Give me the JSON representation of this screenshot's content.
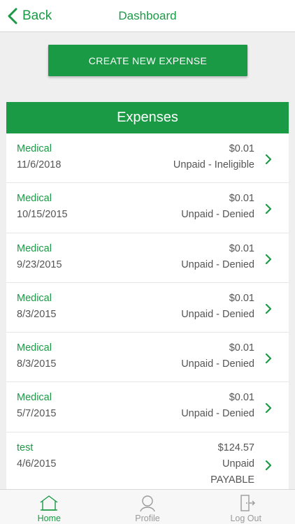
{
  "nav": {
    "back_label": "Back",
    "title": "Dashboard"
  },
  "create_button": "CREATE NEW EXPENSE",
  "expenses": {
    "header": "Expenses",
    "rows": [
      {
        "category": "Medical",
        "date": "11/6/2018",
        "amount": "$0.01",
        "status": "Unpaid - Ineligible"
      },
      {
        "category": "Medical",
        "date": "10/15/2015",
        "amount": "$0.01",
        "status": "Unpaid - Denied"
      },
      {
        "category": "Medical",
        "date": "9/23/2015",
        "amount": "$0.01",
        "status": "Unpaid - Denied"
      },
      {
        "category": "Medical",
        "date": "8/3/2015",
        "amount": "$0.01",
        "status": "Unpaid - Denied"
      },
      {
        "category": "Medical",
        "date": "8/3/2015",
        "amount": "$0.01",
        "status": "Unpaid - Denied"
      },
      {
        "category": "Medical",
        "date": "5/7/2015",
        "amount": "$0.01",
        "status": "Unpaid - Denied"
      },
      {
        "category": "test",
        "date": "4/6/2015",
        "amount": "$124.57",
        "status": "Unpaid",
        "status_line2": "PAYABLE"
      }
    ]
  },
  "tabs": [
    {
      "label": "Home",
      "icon": "home-icon",
      "active": true
    },
    {
      "label": "Profile",
      "icon": "profile-icon",
      "active": false
    },
    {
      "label": "Log Out",
      "icon": "logout-icon",
      "active": false
    }
  ],
  "colors": {
    "accent": "#1a9a45",
    "text": "#555555",
    "background": "#efeff0"
  }
}
